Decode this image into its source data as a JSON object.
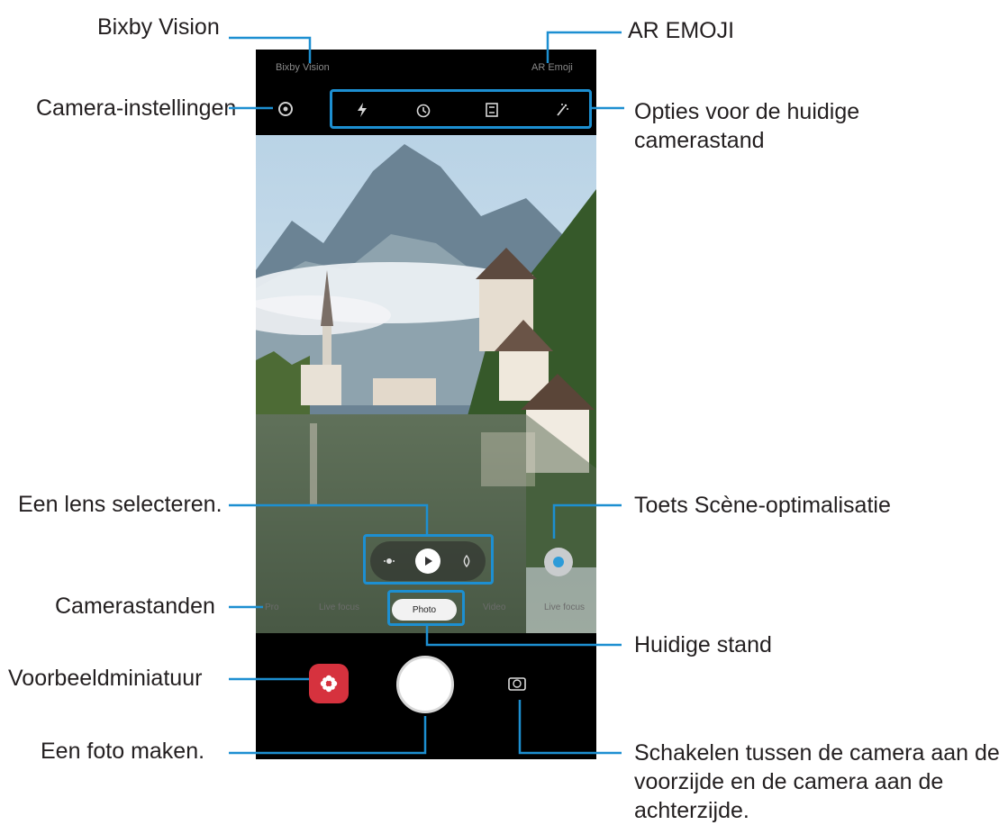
{
  "callouts": {
    "bixby_vision": "Bixby Vision",
    "ar_emoji": "AR EMOJI",
    "camera_settings": "Camera-instellingen",
    "options_current_mode": "Opties voor de huidige camerastand",
    "select_lens": "Een lens selecteren.",
    "scene_optimizer": "Toets Scène-optimalisatie",
    "camera_modes": "Camerastanden",
    "current_mode": "Huidige stand",
    "preview_thumbnail": "Voorbeeldminiatuur",
    "take_photo": "Een foto maken.",
    "switch_camera": "Schakelen tussen de camera aan de voorzijde en de camera aan de achterzijde."
  },
  "phone": {
    "top_left_label": "Bixby Vision",
    "top_right_label": "AR Emoji",
    "modes": [
      "Pro",
      "Live focus",
      "Photo",
      "Video",
      "Live focus"
    ],
    "current_mode_label": "Photo"
  },
  "icons": {
    "settings": "gear-icon",
    "flash": "flash-icon",
    "timer": "timer-icon",
    "ratio": "aspect-ratio-icon",
    "effects": "filter-icon",
    "lens_wide": "ultra-wide-lens-icon",
    "lens_standard": "standard-lens-icon",
    "lens_tele": "telephoto-lens-icon",
    "scene": "scene-optimizer-icon",
    "thumbnail": "gallery-flower-icon",
    "switch": "switch-camera-icon"
  },
  "colors": {
    "callout_line": "#1d8fd1",
    "thumbnail_bg": "#d6323e",
    "phone_bg": "#000000"
  }
}
